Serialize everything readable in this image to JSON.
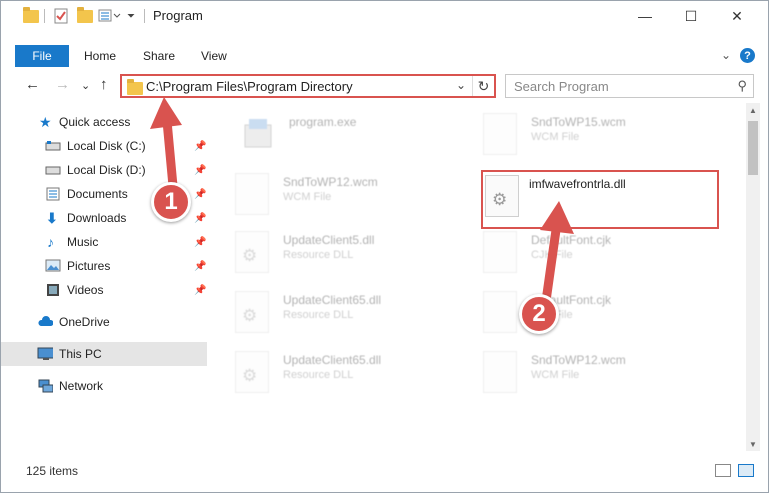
{
  "window": {
    "title": "Program",
    "minimize": "—",
    "maximize": "☐",
    "close": "✕"
  },
  "ribbon": {
    "tabs": [
      "File",
      "Home",
      "Share",
      "View"
    ],
    "collapse": "⌄",
    "help": "?"
  },
  "nav": {
    "back": "←",
    "forward": "→",
    "recent": "⌄",
    "up": "↑",
    "address": "C:\\Program Files\\Program Directory",
    "address_dropdown": "⌄",
    "refresh": "↻",
    "search_placeholder": "Search Program",
    "search_icon": "⚲"
  },
  "sidebar": {
    "items": [
      {
        "label": "Quick access",
        "icon": "star-icon",
        "pinned": false
      },
      {
        "label": "Local Disk (C:)",
        "icon": "drive-icon",
        "pinned": true
      },
      {
        "label": "Local Disk (D:)",
        "icon": "drive-icon",
        "pinned": true
      },
      {
        "label": "Documents",
        "icon": "documents-icon",
        "pinned": true
      },
      {
        "label": "Downloads",
        "icon": "download-icon",
        "pinned": true
      },
      {
        "label": "Music",
        "icon": "music-icon",
        "pinned": true
      },
      {
        "label": "Pictures",
        "icon": "pictures-icon",
        "pinned": true
      },
      {
        "label": "Videos",
        "icon": "video-icon",
        "pinned": true
      },
      {
        "label": "OneDrive",
        "icon": "cloud-icon",
        "pinned": false
      },
      {
        "label": "This PC",
        "icon": "computer-icon",
        "pinned": false,
        "selected": true
      },
      {
        "label": "Network",
        "icon": "network-icon",
        "pinned": false
      }
    ],
    "pin_glyph": "📌"
  },
  "files": [
    {
      "name": "program.exe",
      "type": "",
      "faded": true
    },
    {
      "name": "SndToWP15.wcm",
      "type": "WCM File",
      "faded": true
    },
    {
      "name": "SndToWP12.wcm",
      "type": "WCM File",
      "faded": true
    },
    {
      "name": "imfwavefrontrla.dll",
      "type": "",
      "faded": false
    },
    {
      "name": "UpdateClient5.dll",
      "type": "Resource DLL",
      "faded": true
    },
    {
      "name": "DefaultFont.cjk",
      "type": "CJK File",
      "faded": true
    },
    {
      "name": "UpdateClient65.dll",
      "type": "Resource DLL",
      "faded": true
    },
    {
      "name": "DefaultFont.cjk",
      "type": "CJK File",
      "faded": true
    },
    {
      "name": "UpdateClient65.dll",
      "type": "Resource DLL",
      "faded": true
    },
    {
      "name": "SndToWP12.wcm",
      "type": "WCM File",
      "faded": true
    }
  ],
  "status": {
    "count": "125 items"
  },
  "annotations": {
    "step1": "1",
    "step2": "2"
  },
  "colors": {
    "accent": "#1979ca",
    "highlight": "#d9534f"
  }
}
